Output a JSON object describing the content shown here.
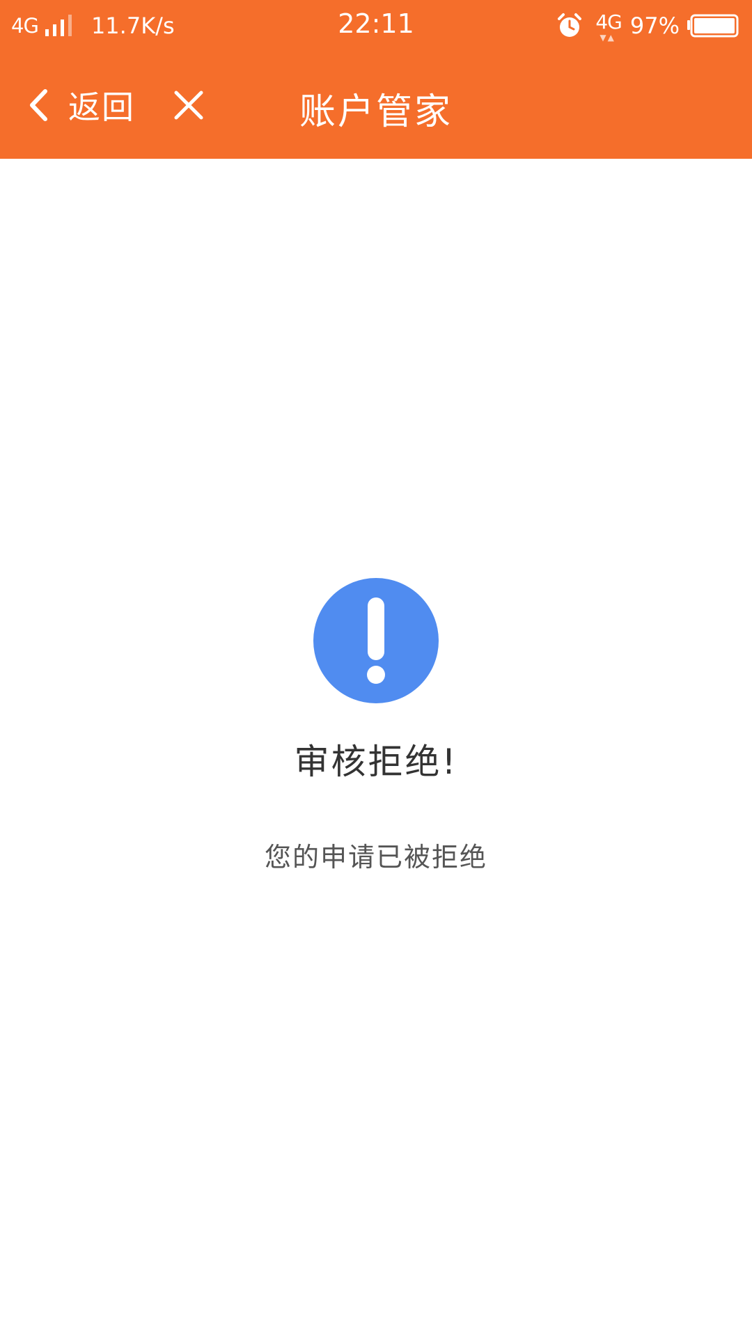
{
  "status_bar": {
    "network": "4G",
    "speed": "11.7K/s",
    "time": "22:11",
    "network_right": "4G",
    "battery": "97%"
  },
  "nav": {
    "back_label": "返回",
    "title": "账户管家",
    "icons": {
      "back": "chevron-left-icon",
      "close": "close-icon"
    }
  },
  "result": {
    "icon": "exclamation-circle-icon",
    "title": "审核拒绝!",
    "description": "您的申请已被拒绝"
  },
  "colors": {
    "header_background": "#f56e2b",
    "alert_icon": "#508cf0",
    "title_text": "#333333",
    "description_text": "#555555"
  }
}
